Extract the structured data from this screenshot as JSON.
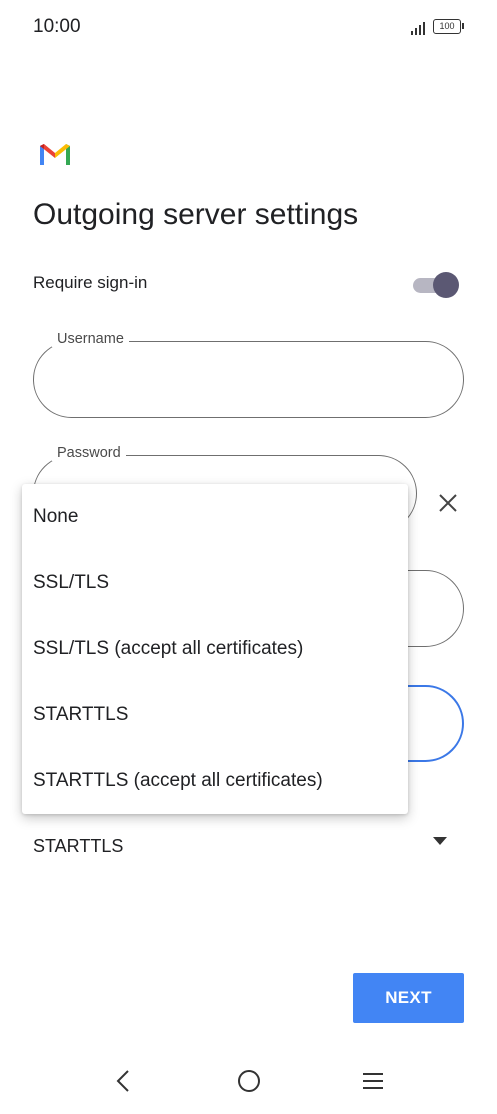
{
  "status_bar": {
    "time": "10:00",
    "battery": "100"
  },
  "screen": {
    "title": "Outgoing server settings"
  },
  "sign_in": {
    "label": "Require sign-in",
    "enabled": true
  },
  "fields": {
    "username": {
      "label": "Username",
      "value": ""
    },
    "password": {
      "label": "Password",
      "value": ""
    }
  },
  "security": {
    "selected": "STARTTLS",
    "options": [
      "None",
      "SSL/TLS",
      "SSL/TLS (accept all certificates)",
      "STARTTLS",
      "STARTTLS (accept all certificates)"
    ]
  },
  "actions": {
    "next_label": "NEXT"
  },
  "colors": {
    "accent": "#4285f4",
    "toggle_knob": "#5b5873",
    "focus_border": "#3b78e7"
  },
  "icons": {
    "logo": "gmail-logo",
    "clear": "close-icon",
    "dropdown": "caret-down-icon",
    "nav": [
      "back-icon",
      "home-icon",
      "menu-icon"
    ]
  }
}
